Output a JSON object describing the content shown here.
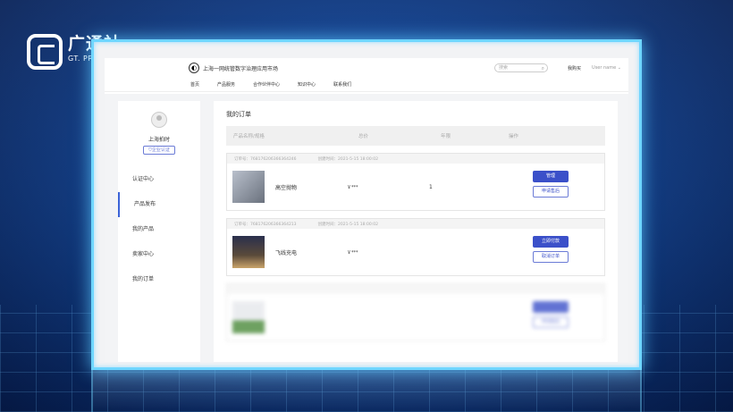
{
  "watermark": {
    "cn": "广通社",
    "en": "GT. PRNEWS"
  },
  "site": {
    "title": "上海一网统管数字治理应用市场",
    "search_placeholder": "搜索",
    "purchased": "我购买",
    "username": "User name"
  },
  "nav": [
    "首页",
    "产品服务",
    "合作伙伴中心",
    "知识中心",
    "联系我们"
  ],
  "user": {
    "name": "上海拍时",
    "badge": "企业认证"
  },
  "sidebar": {
    "items": [
      {
        "label": "认证中心"
      },
      {
        "label": "产品发布"
      },
      {
        "label": "我的产品"
      },
      {
        "label": "卖家中心"
      },
      {
        "label": "我的订单"
      }
    ]
  },
  "main": {
    "title": "我的订单",
    "columns": [
      "产品名称/规格",
      "总价",
      "年限",
      "操作"
    ]
  },
  "orders": [
    {
      "order_no": "订单号：768176206366364246",
      "created": "创建时间：2021-5-15 18:00:02",
      "name": "高空抛物",
      "price": "￥***",
      "qty": "1",
      "btn1": "管理",
      "btn2": "申请售后"
    },
    {
      "order_no": "订单号：768176206366364213",
      "created": "创建时间：2021-5-15 18:00:02",
      "name": "飞线充电",
      "price": "￥***",
      "qty": "",
      "btn1": "立即付款",
      "btn2": "取消订单"
    },
    {
      "order_no": "",
      "created": "",
      "name": "",
      "price": "",
      "qty": "",
      "btn1": "",
      "btn2": "申请售后"
    }
  ]
}
